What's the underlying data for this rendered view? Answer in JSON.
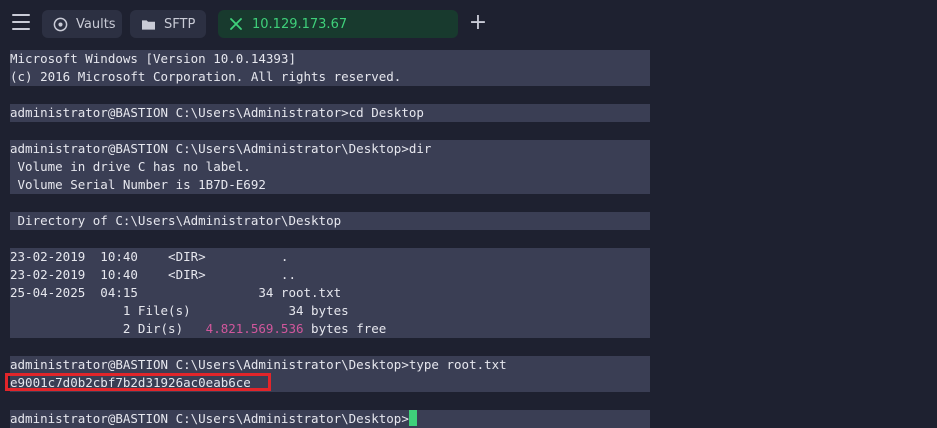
{
  "topbar": {
    "tabs": [
      {
        "label": "Vaults",
        "icon": "vault-icon"
      },
      {
        "label": "SFTP",
        "icon": "folder-icon"
      },
      {
        "label": "10.129.173.67",
        "icon": "close-icon",
        "active": true
      }
    ],
    "add_label": "+"
  },
  "terminal": {
    "lines": [
      "Microsoft Windows [Version 10.0.14393]",
      "(c) 2016 Microsoft Corporation. All rights reserved.",
      "administrator@BASTION C:\\Users\\Administrator>cd Desktop",
      "administrator@BASTION C:\\Users\\Administrator\\Desktop>dir",
      " Volume in drive C has no label.",
      " Volume Serial Number is 1B7D-E692",
      " Directory of C:\\Users\\Administrator\\Desktop",
      "23-02-2019  10:40    <DIR>          .",
      "23-02-2019  10:40    <DIR>          ..",
      "25-04-2025  04:15                34 root.txt",
      "               1 File(s)             34 bytes",
      "               2 Dir(s)   ",
      "4.821.569.536",
      " bytes free",
      "administrator@BASTION C:\\Users\\Administrator\\Desktop>type root.txt",
      "e9001c7d0b2cbf7b2d31926ac0eab6ce",
      "administrator@BASTION C:\\Users\\Administrator\\Desktop>"
    ]
  },
  "colors": {
    "background": "#1e2130",
    "line_bg": "#3a3e54",
    "accent_green": "#3fd07a",
    "highlight_red": "#e2252a",
    "number_magenta": "#d1579c"
  }
}
